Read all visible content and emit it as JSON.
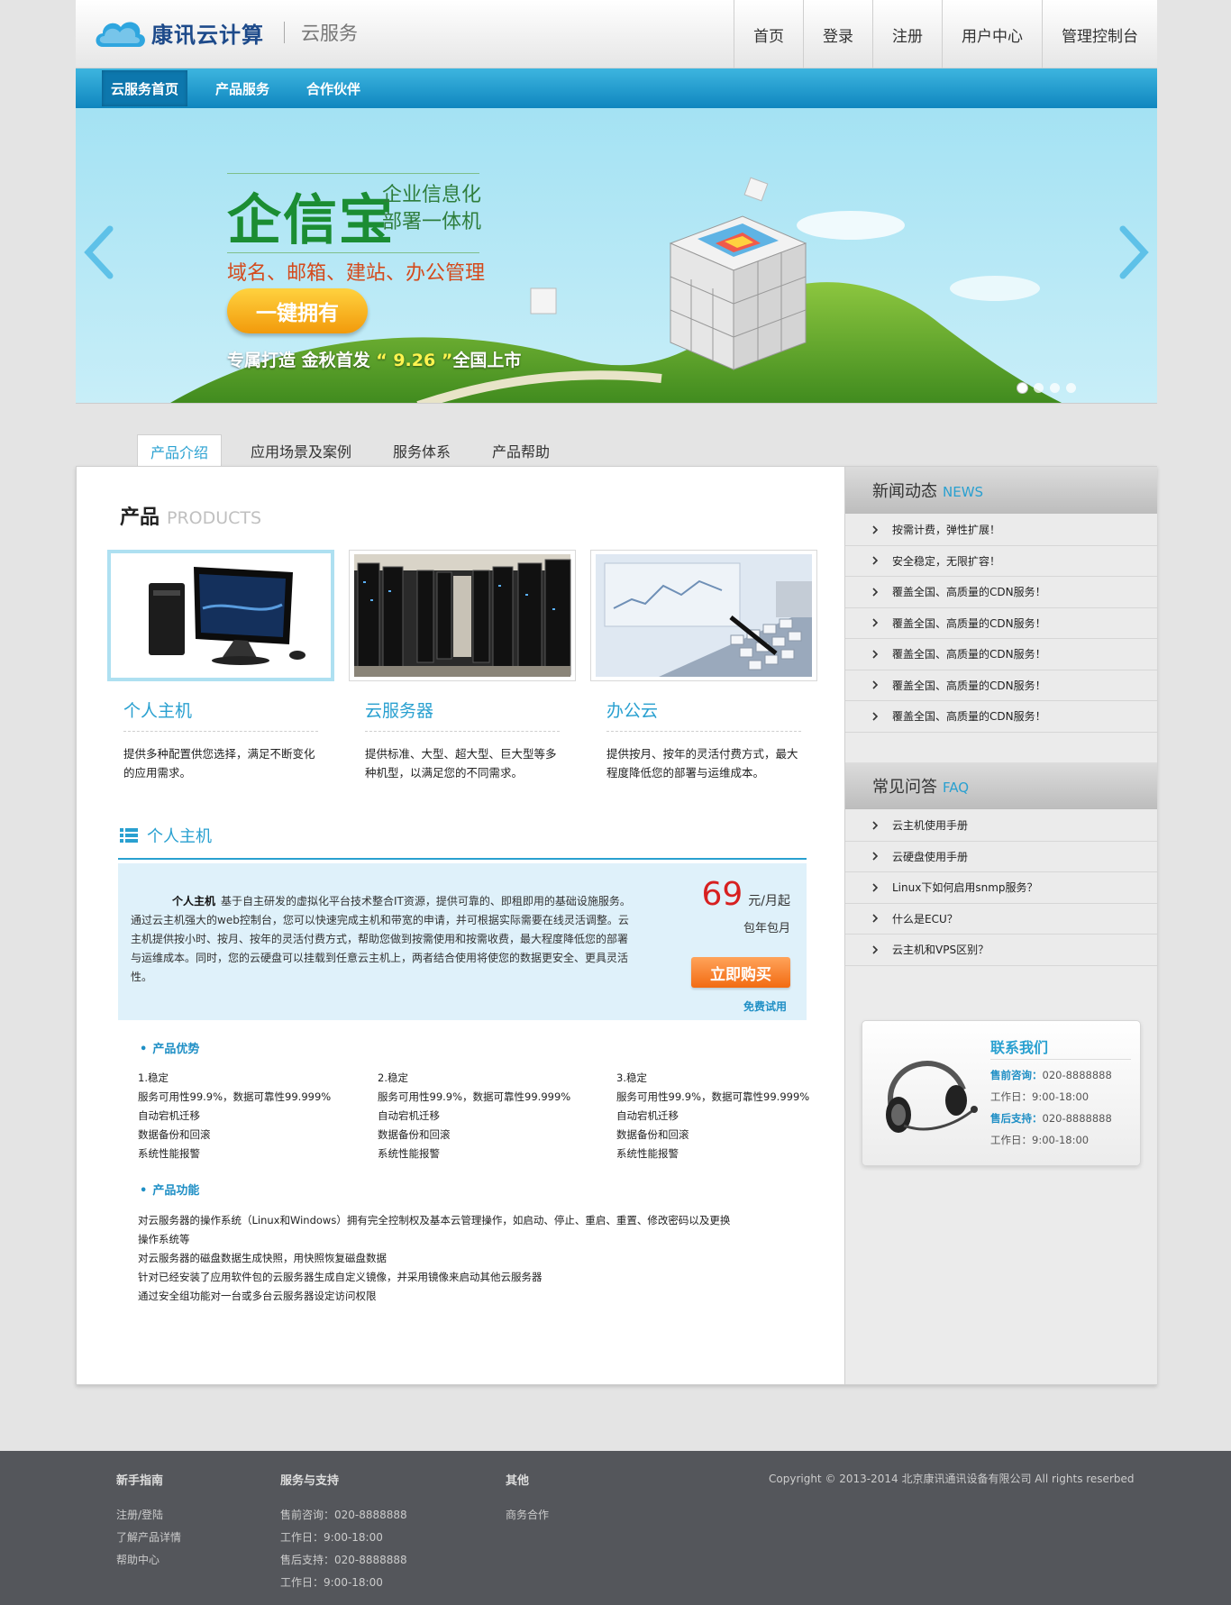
{
  "header": {
    "logo_text": "康讯云计算",
    "logo_sub": "云服务",
    "nav": [
      "首页",
      "登录",
      "注册",
      "用户中心",
      "管理控制台"
    ]
  },
  "bluenav": {
    "items": [
      "云服务首页",
      "产品服务",
      "合作伙伴"
    ]
  },
  "banner": {
    "title": "企信宝",
    "subtitle_1": "企业信息化",
    "subtitle_2": "部署一体机",
    "services": "域名、邮箱、建站、办公管理",
    "button": "一键拥有",
    "foot_1": "专属打造  金秋首发 ",
    "foot_date": "“ 9.26 ”",
    "foot_2": "全国上市",
    "slide_count": 4,
    "active_slide": 1
  },
  "tabs": [
    "产品介绍",
    "应用场景及案例",
    "服务体系",
    "产品帮助"
  ],
  "products": {
    "title_cn": "产品",
    "title_en": "PRODUCTS",
    "items": [
      {
        "name": "个人主机",
        "desc": "提供多种配置供您选择，满足不断变化的应用需求。",
        "image": "desktop-computer"
      },
      {
        "name": "云服务器",
        "desc": "提供标准、大型、超大型、巨大型等多种机型，以满足您的不同需求。",
        "image": "server-room"
      },
      {
        "name": "办公云",
        "desc": "提供按月、按年的灵活付费方式，最大程度降低您的部署与运维成本。",
        "image": "laptop-keyboard"
      }
    ]
  },
  "host": {
    "heading": "个人主机",
    "desc_bold": "个人主机",
    "desc": "基于自主研发的虚拟化平台技术整合IT资源，提供可靠的、即租即用的基础设施服务。通过云主机强大的web控制台，您可以快速完成主机和带宽的申请，并可根据实际需要在线灵活调整。云主机提供按小时、按月、按年的灵活付费方式，帮助您做到按需使用和按需收费，最大程度降低您的部署与运维成本。同时，您的云硬盘可以挂载到任意云主机上，两者结合使用将使您的数据更安全、更具灵活性。",
    "price": "69",
    "price_unit": "元/月起",
    "price_sub": "包年包月",
    "buy": "立即购买",
    "trial": "免费试用"
  },
  "advantages": {
    "title": "产品优势",
    "cols": [
      [
        "1.稳定",
        "服务可用性99.9%，数据可靠性99.999%",
        "自动宕机迁移",
        "数据备份和回滚",
        "系统性能报警"
      ],
      [
        "2.稳定",
        "服务可用性99.9%，数据可靠性99.999%",
        "自动宕机迁移",
        "数据备份和回滚",
        "系统性能报警"
      ],
      [
        "3.稳定",
        "服务可用性99.9%，数据可靠性99.999%",
        "自动宕机迁移",
        "数据备份和回滚",
        "系统性能报警"
      ]
    ]
  },
  "functions": {
    "title": "产品功能",
    "lines": [
      "对云服务器的操作系统（Linux和Windows）拥有完全控制权及基本云管理操作，如启动、停止、重启、重置、修改密码以及更换",
      "操作系统等",
      "对云服务器的磁盘数据生成快照，用快照恢复磁盘数据",
      "针对已经安装了应用软件包的云服务器生成自定义镜像，并采用镜像来启动其他云服务器",
      "通过安全组功能对一台或多台云服务器设定访问权限"
    ]
  },
  "news": {
    "title_cn": "新闻动态",
    "title_en": "NEWS",
    "items": [
      "按需计费，弹性扩展！",
      "安全稳定，无限扩容！",
      "覆盖全国、高质量的CDN服务！",
      "覆盖全国、高质量的CDN服务！",
      "覆盖全国、高质量的CDN服务！",
      "覆盖全国、高质量的CDN服务！",
      "覆盖全国、高质量的CDN服务！"
    ]
  },
  "faq": {
    "title_cn": "常见问答",
    "title_en": "FAQ",
    "items": [
      "云主机使用手册",
      "云硬盘使用手册",
      "Linux下如何启用snmp服务？",
      "什么是ECU？",
      "云主机和VPS区别？"
    ]
  },
  "contact": {
    "title": "联系我们",
    "pre_label": "售前咨询：",
    "pre_phone": "020-8888888",
    "pre_hours": "工作日：9:00-18:00",
    "after_label": "售后支持：",
    "after_phone": "020-8888888",
    "after_hours": "工作日：9:00-18:00"
  },
  "footer": {
    "col1": {
      "title": "新手指南",
      "items": [
        "注册/登陆",
        "了解产品详情",
        "帮助中心"
      ]
    },
    "col2": {
      "title": "服务与支持",
      "items": [
        "售前咨询：020-8888888",
        "工作日：9:00-18:00",
        "售后支持：020-8888888",
        "工作日：9:00-18:00"
      ]
    },
    "col3": {
      "title": "其他",
      "items": [
        "商务合作"
      ]
    },
    "copyright": "Copyright © 2013-2014  北京康讯通讯设备有限公司   All rights reserbed"
  },
  "colors": {
    "accent": "#29a0d0",
    "nav_blue": "#1a95cc",
    "price_red": "#d72020",
    "buy_orange": "#f26b12",
    "footer_bg": "#54565b"
  }
}
